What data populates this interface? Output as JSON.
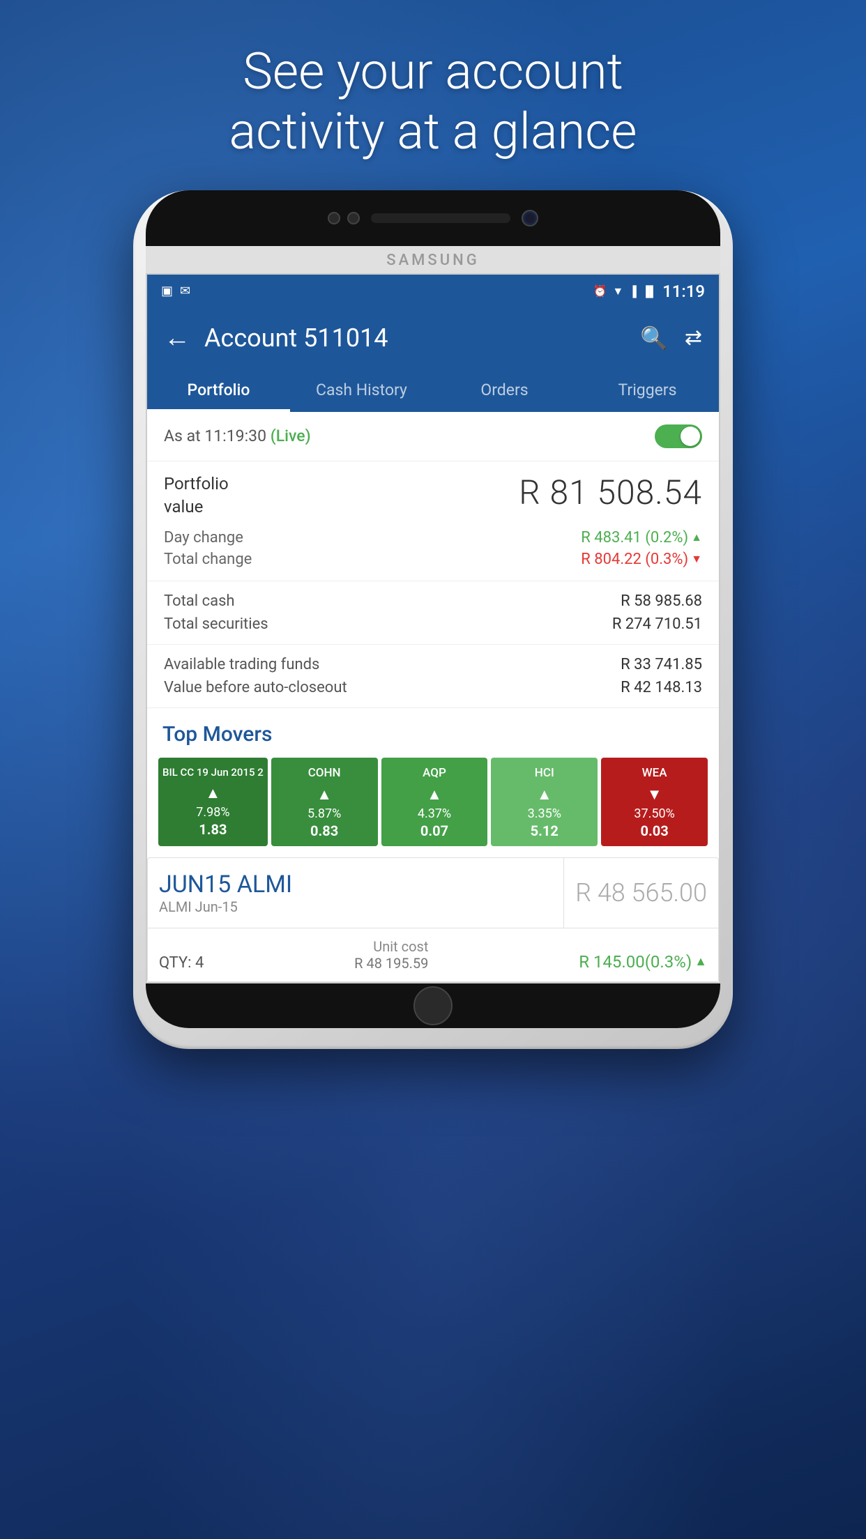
{
  "hero": {
    "line1": "See your account",
    "line2": "activity at a glance"
  },
  "phone": {
    "brand": "SAMSUNG"
  },
  "statusBar": {
    "time": "11:19",
    "icons_left": [
      "image",
      "email"
    ],
    "icons_right": [
      "alarm",
      "wifi",
      "signal",
      "battery"
    ]
  },
  "header": {
    "title": "Account 511014",
    "back_label": "←",
    "search_label": "🔍",
    "transfer_label": "⇄"
  },
  "tabs": [
    {
      "label": "Portfolio",
      "active": true
    },
    {
      "label": "Cash History",
      "active": false
    },
    {
      "label": "Orders",
      "active": false
    },
    {
      "label": "Triggers",
      "active": false
    }
  ],
  "liveStatus": {
    "text": "As at 11:19:30",
    "live_label": "(Live)",
    "toggle_on": true
  },
  "portfolio": {
    "label_line1": "Portfolio",
    "label_line2": "value",
    "value": "R 81 508.54",
    "dayChange_label": "Day change",
    "dayChange_value": "R 483.41 (0.2%)",
    "dayChange_direction": "up",
    "totalChange_label": "Total change",
    "totalChange_value": "R 804.22 (0.3%)",
    "totalChange_direction": "down"
  },
  "funds": {
    "totalCash_label": "Total cash",
    "totalCash_value": "R 58 985.68",
    "totalSecurities_label": "Total securities",
    "totalSecurities_value": "R 274 710.51"
  },
  "trading": {
    "availableFunds_label": "Available trading funds",
    "availableFunds_value": "R 33 741.85",
    "valueBeforeCloseout_label": "Value before auto-closeout",
    "valueBeforeCloseout_value": "R 42 148.13"
  },
  "topMovers": {
    "title": "Top Movers",
    "items": [
      {
        "name": "BIL CC 19 Jun 2015 2",
        "pct": "7.98%",
        "val": "1.83",
        "direction": "up",
        "color": "green-dark"
      },
      {
        "name": "COHN",
        "pct": "5.87%",
        "val": "0.83",
        "direction": "up",
        "color": "green-med"
      },
      {
        "name": "AQP",
        "pct": "4.37%",
        "val": "0.07",
        "direction": "up",
        "color": "green-light"
      },
      {
        "name": "HCI",
        "pct": "3.35%",
        "val": "5.12",
        "direction": "up",
        "color": "green-bright"
      },
      {
        "name": "WEA",
        "pct": "37.50%",
        "val": "0.03",
        "direction": "down",
        "color": "red"
      }
    ]
  },
  "securityCard": {
    "name": "JUN15 ALMI",
    "sub": "ALMI Jun-15",
    "price": "R 48 565.00",
    "qty_label": "QTY: 4",
    "unitCost_label": "Unit cost",
    "unitCost_value": "R 48 195.59",
    "change_value": "R 145.00(0.3%)",
    "change_direction": "up"
  }
}
